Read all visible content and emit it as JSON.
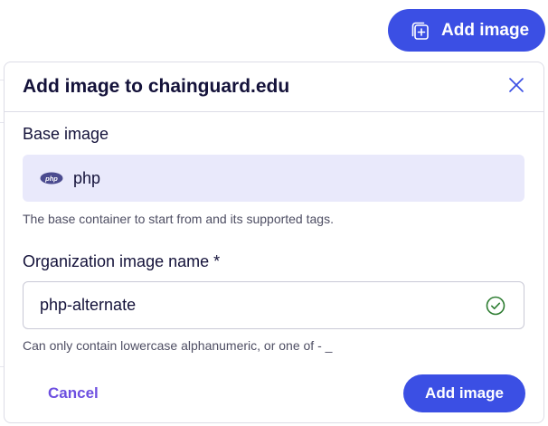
{
  "toolbar": {
    "add_image_label": "Add image",
    "add_image_icon": "add-image-icon"
  },
  "modal": {
    "title": "Add image to chainguard.edu",
    "close_icon": "close-icon",
    "base_image": {
      "label": "Base image",
      "value": "php",
      "logo": "php-logo",
      "helper": "The base container to start from and its supported tags."
    },
    "org_image_name": {
      "label": "Organization image name *",
      "value": "php-alternate",
      "status_icon": "check-circle-icon",
      "helper": "Can only contain lowercase alphanumeric, or one of - _"
    },
    "cancel_label": "Cancel",
    "submit_label": "Add image"
  },
  "colors": {
    "primary": "#3b4fe4",
    "link": "#6d4fe0",
    "valid": "#2e7d32",
    "select_bg": "#e9e9fb"
  }
}
